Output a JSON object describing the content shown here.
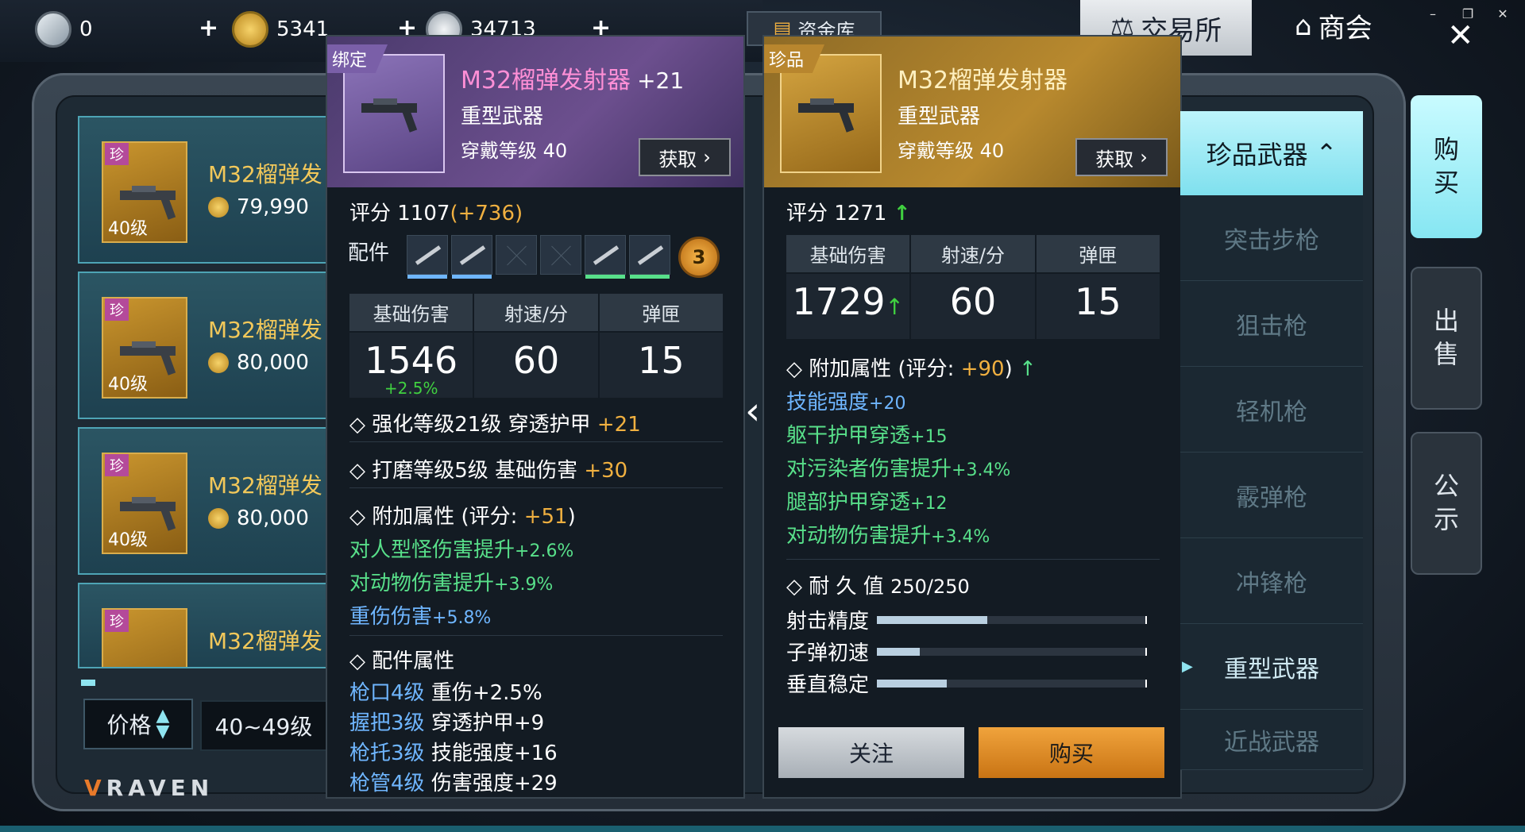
{
  "window": {
    "minimize": "–",
    "restore": "❐",
    "close": "✕"
  },
  "currency": {
    "silver": "0",
    "gold": "5341",
    "coins": "34713",
    "vault_label": "资金库"
  },
  "top_tabs": {
    "trade": "交易所",
    "guild": "商会"
  },
  "listings": [
    {
      "badge": "珍",
      "level": "40级",
      "name": "M32榴弹发",
      "price": "79,990"
    },
    {
      "badge": "珍",
      "level": "40级",
      "name": "M32榴弹发",
      "price": "80,000"
    },
    {
      "badge": "珍",
      "level": "40级",
      "name": "M32榴弹发",
      "price": "80,000"
    },
    {
      "badge": "珍",
      "level": "",
      "name": "M32榴弹发",
      "price": ""
    }
  ],
  "filters": {
    "sort_label": "价格",
    "level_range": "40~49级"
  },
  "brand": {
    "logo_v": "V",
    "logo_text": "RAVEN"
  },
  "left_item": {
    "tag": "绑定",
    "title": "M32榴弹发射器",
    "plus": "+21",
    "type": "重型武器",
    "wear": "穿戴等级 40",
    "get_label": "获取",
    "score_label": "评分 1107",
    "score_inc": "(+736)",
    "acc_label": "配件",
    "acc_count": "3",
    "stat_headers": [
      "基础伤害",
      "射速/分",
      "弹匣"
    ],
    "stat_values": [
      "1546",
      "60",
      "15"
    ],
    "dmg_bonus": "+2.5%",
    "enhance_text": "◇ 强化等级21级 穿透护甲",
    "enhance_val": "+21",
    "polish_text": "◇ 打磨等级5级 基础伤害",
    "polish_val": "+30",
    "extra_text": "◇ 附加属性 (评分:",
    "extra_val": "+51",
    "extra_end": ")",
    "extra_attrs": [
      {
        "name": "对人型怪伤害提升",
        "val": "+2.6%",
        "color": "green"
      },
      {
        "name": "对动物伤害提升",
        "val": "+3.9%",
        "color": "green"
      },
      {
        "name": "重伤伤害",
        "val": "+5.8%",
        "color": "blue"
      }
    ],
    "parts_title": "◇ 配件属性",
    "parts": [
      {
        "slot": "枪口4级",
        "effect": "重伤+2.5%"
      },
      {
        "slot": "握把3级",
        "effect": "穿透护甲+9"
      },
      {
        "slot": "枪托3级",
        "effect": "技能强度+16"
      },
      {
        "slot": "枪管4级",
        "effect": "伤害强度+29"
      }
    ]
  },
  "right_item": {
    "tag": "珍品",
    "title": "M32榴弹发射器",
    "type": "重型武器",
    "wear": "穿戴等级 40",
    "get_label": "获取",
    "score_label": "评分 1271",
    "stat_headers": [
      "基础伤害",
      "射速/分",
      "弹匣"
    ],
    "stat_values": [
      "1729",
      "60",
      "15"
    ],
    "extra_text": "◇ 附加属性 (评分:",
    "extra_val": "+90",
    "extra_end": ")",
    "extra_attrs": [
      {
        "name": "技能强度",
        "val": "+20",
        "color": "blue"
      },
      {
        "name": "躯干护甲穿透",
        "val": "+15",
        "color": "green"
      },
      {
        "name": "对污染者伤害提升",
        "val": "+3.4%",
        "color": "green"
      },
      {
        "name": "腿部护甲穿透",
        "val": "+12",
        "color": "green"
      },
      {
        "name": "对动物伤害提升",
        "val": "+3.4%",
        "color": "green"
      }
    ],
    "durability_label": "◇ 耐 久 值",
    "durability_value": "250/250",
    "bars": [
      {
        "label": "射击精度",
        "fraction": 0.41
      },
      {
        "label": "子弹初速",
        "fraction": 0.16
      },
      {
        "label": "垂直稳定",
        "fraction": 0.26
      }
    ],
    "follow_label": "关注",
    "buy_label": "购买"
  },
  "categories": {
    "header": "珍品武器",
    "items": [
      "突击步枪",
      "狙击枪",
      "轻机枪",
      "霰弹枪",
      "冲锋枪",
      "重型武器",
      "近战武器"
    ],
    "active_index": 5
  },
  "side_tabs": {
    "buy": "购\n买",
    "sell": "出\n售",
    "notice": "公\n示"
  },
  "colors": {
    "accent_cyan": "#86e6f2",
    "gold": "#f0b040",
    "green": "#58e08a",
    "blue": "#6fb6ff",
    "pink": "#ff8fd6"
  }
}
